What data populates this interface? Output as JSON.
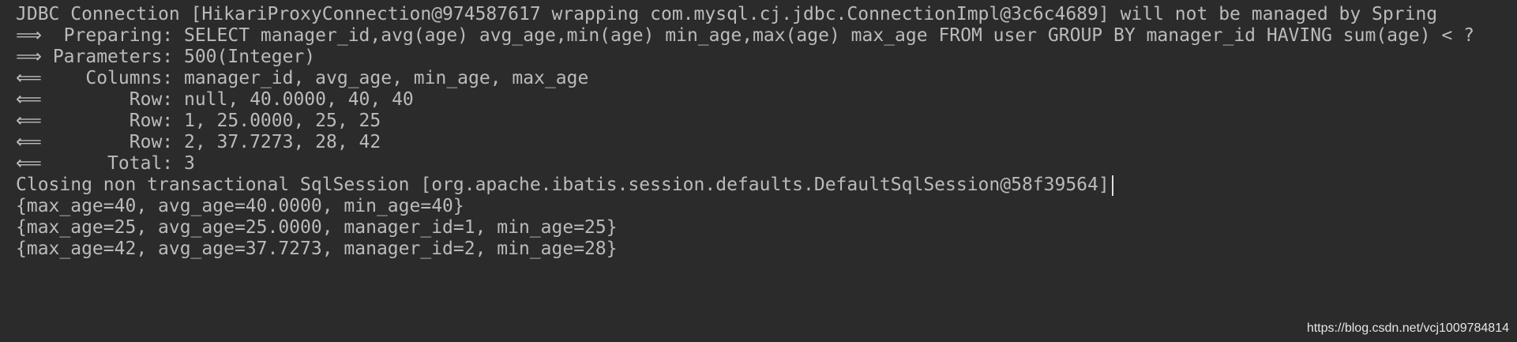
{
  "console": {
    "lines": [
      "JDBC Connection [HikariProxyConnection@974587617 wrapping com.mysql.cj.jdbc.ConnectionImpl@3c6c4689] will not be managed by Spring",
      "⟹  Preparing: SELECT manager_id,avg(age) avg_age,min(age) min_age,max(age) max_age FROM user GROUP BY manager_id HAVING sum(age) < ?",
      "⟹ Parameters: 500(Integer)",
      "⟸    Columns: manager_id, avg_age, min_age, max_age",
      "⟸        Row: null, 40.0000, 40, 40",
      "⟸        Row: 1, 25.0000, 25, 25",
      "⟸        Row: 2, 37.7273, 28, 42",
      "⟸      Total: 3",
      "Closing non transactional SqlSession [org.apache.ibatis.session.defaults.DefaultSqlSession@58f39564]",
      "{max_age=40, avg_age=40.0000, min_age=40}",
      "{max_age=25, avg_age=25.0000, manager_id=1, min_age=25}",
      "{max_age=42, avg_age=37.7273, manager_id=2, min_age=28}"
    ]
  },
  "watermark": "https://blog.csdn.net/vcj1009784814",
  "colors": {
    "background": "#2b2b2b",
    "text": "#bbbbbb"
  }
}
